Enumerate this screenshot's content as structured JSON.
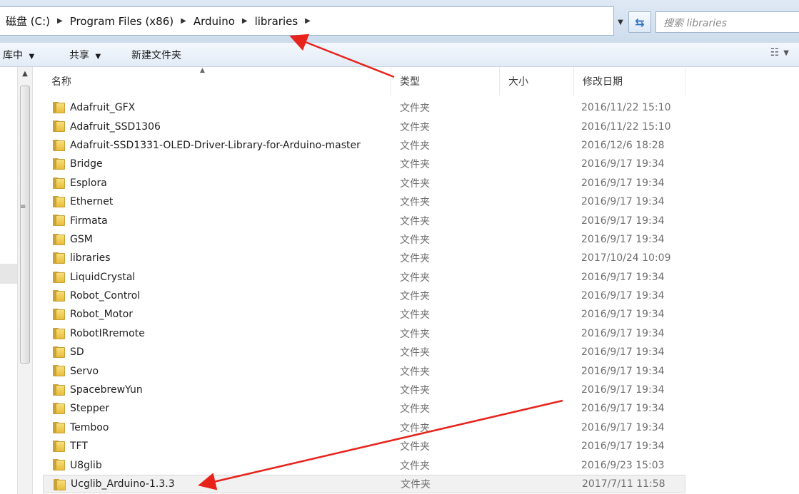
{
  "address_bar": {
    "crumbs": [
      "磁盘 (C:)",
      "Program Files (x86)",
      "Arduino",
      "libraries"
    ],
    "search_placeholder": "搜索 libraries"
  },
  "toolbar": {
    "library_label": "库中",
    "share_label": "共享",
    "new_folder_label": "新建文件夹"
  },
  "columns": {
    "name": "名称",
    "type": "类型",
    "size": "大小",
    "date": "修改日期"
  },
  "files": [
    {
      "name": "Adafruit_GFX",
      "type": "文件夹",
      "date": "2016/11/22 15:10"
    },
    {
      "name": "Adafruit_SSD1306",
      "type": "文件夹",
      "date": "2016/11/22 15:10"
    },
    {
      "name": "Adafruit-SSD1331-OLED-Driver-Library-for-Arduino-master",
      "type": "文件夹",
      "date": "2016/12/6 18:28"
    },
    {
      "name": "Bridge",
      "type": "文件夹",
      "date": "2016/9/17 19:34"
    },
    {
      "name": "Esplora",
      "type": "文件夹",
      "date": "2016/9/17 19:34"
    },
    {
      "name": "Ethernet",
      "type": "文件夹",
      "date": "2016/9/17 19:34"
    },
    {
      "name": "Firmata",
      "type": "文件夹",
      "date": "2016/9/17 19:34"
    },
    {
      "name": "GSM",
      "type": "文件夹",
      "date": "2016/9/17 19:34"
    },
    {
      "name": "libraries",
      "type": "文件夹",
      "date": "2017/10/24 10:09"
    },
    {
      "name": "LiquidCrystal",
      "type": "文件夹",
      "date": "2016/9/17 19:34"
    },
    {
      "name": "Robot_Control",
      "type": "文件夹",
      "date": "2016/9/17 19:34"
    },
    {
      "name": "Robot_Motor",
      "type": "文件夹",
      "date": "2016/9/17 19:34"
    },
    {
      "name": "RobotIRremote",
      "type": "文件夹",
      "date": "2016/9/17 19:34"
    },
    {
      "name": "SD",
      "type": "文件夹",
      "date": "2016/9/17 19:34"
    },
    {
      "name": "Servo",
      "type": "文件夹",
      "date": "2016/9/17 19:34"
    },
    {
      "name": "SpacebrewYun",
      "type": "文件夹",
      "date": "2016/9/17 19:34"
    },
    {
      "name": "Stepper",
      "type": "文件夹",
      "date": "2016/9/17 19:34"
    },
    {
      "name": "Temboo",
      "type": "文件夹",
      "date": "2016/9/17 19:34"
    },
    {
      "name": "TFT",
      "type": "文件夹",
      "date": "2016/9/17 19:34"
    },
    {
      "name": "U8glib",
      "type": "文件夹",
      "date": "2016/9/23 15:03"
    },
    {
      "name": "Ucglib_Arduino-1.3.3",
      "type": "文件夹",
      "date": "2017/7/11 11:58",
      "selected": true
    }
  ],
  "colors": {
    "annotation_arrow": "#e8231c",
    "folder": "#e9bd3c",
    "selection_bg": "#f1f1f1"
  }
}
